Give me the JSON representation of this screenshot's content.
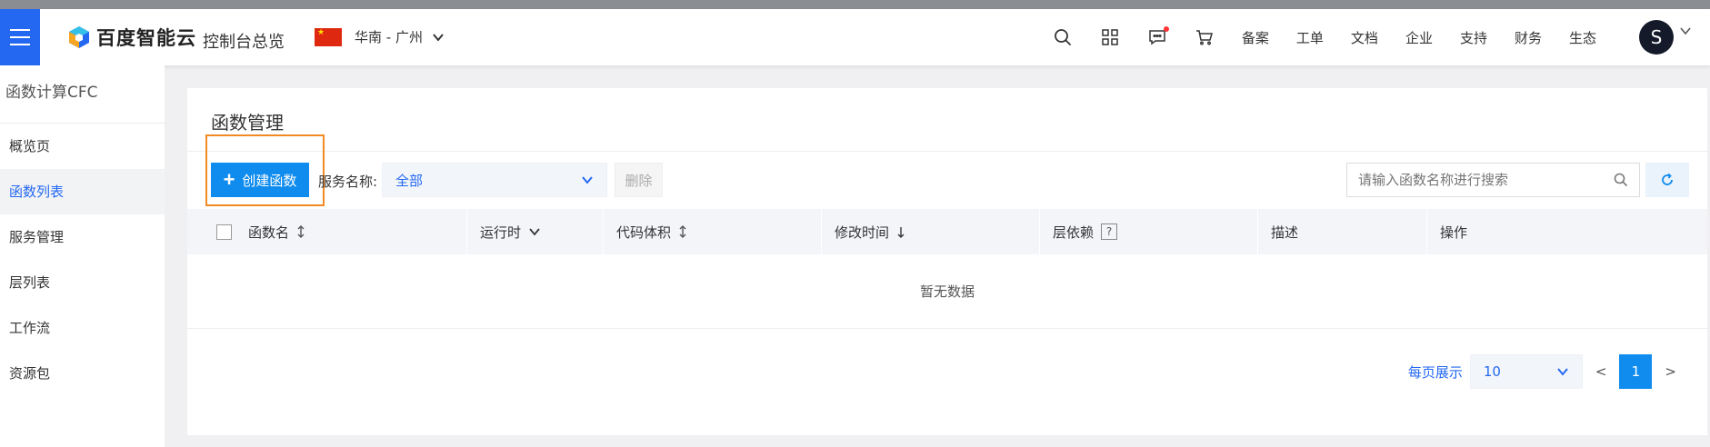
{
  "header": {
    "logo_text": "百度智能云",
    "console_title": "控制台总览",
    "region": "华南 - 广州",
    "nav_links": [
      "备案",
      "工单",
      "文档",
      "企业",
      "支持",
      "财务",
      "生态"
    ],
    "avatar_letter": "S"
  },
  "sidebar": {
    "title": "函数计算CFC",
    "items": [
      {
        "label": "概览页"
      },
      {
        "label": "函数列表"
      },
      {
        "label": "服务管理"
      },
      {
        "label": "层列表"
      },
      {
        "label": "工作流"
      },
      {
        "label": "资源包"
      }
    ]
  },
  "main": {
    "title": "函数管理",
    "create_button": "创建函数",
    "service_label": "服务名称:",
    "service_value": "全部",
    "delete_button": "删除",
    "search_placeholder": "请输入函数名称进行搜索",
    "columns": [
      "函数名",
      "运行时",
      "代码体积",
      "修改时间",
      "层依赖",
      "描述",
      "操作"
    ],
    "qmark": "?",
    "empty_text": "暂无数据",
    "pager": {
      "label": "每页展示",
      "page_size": "10",
      "prev": "<",
      "current_page": "1",
      "next": ">"
    }
  },
  "colors": {
    "brand": "#2468f2",
    "primary_button": "#108cee",
    "highlight": "#f28a23"
  }
}
